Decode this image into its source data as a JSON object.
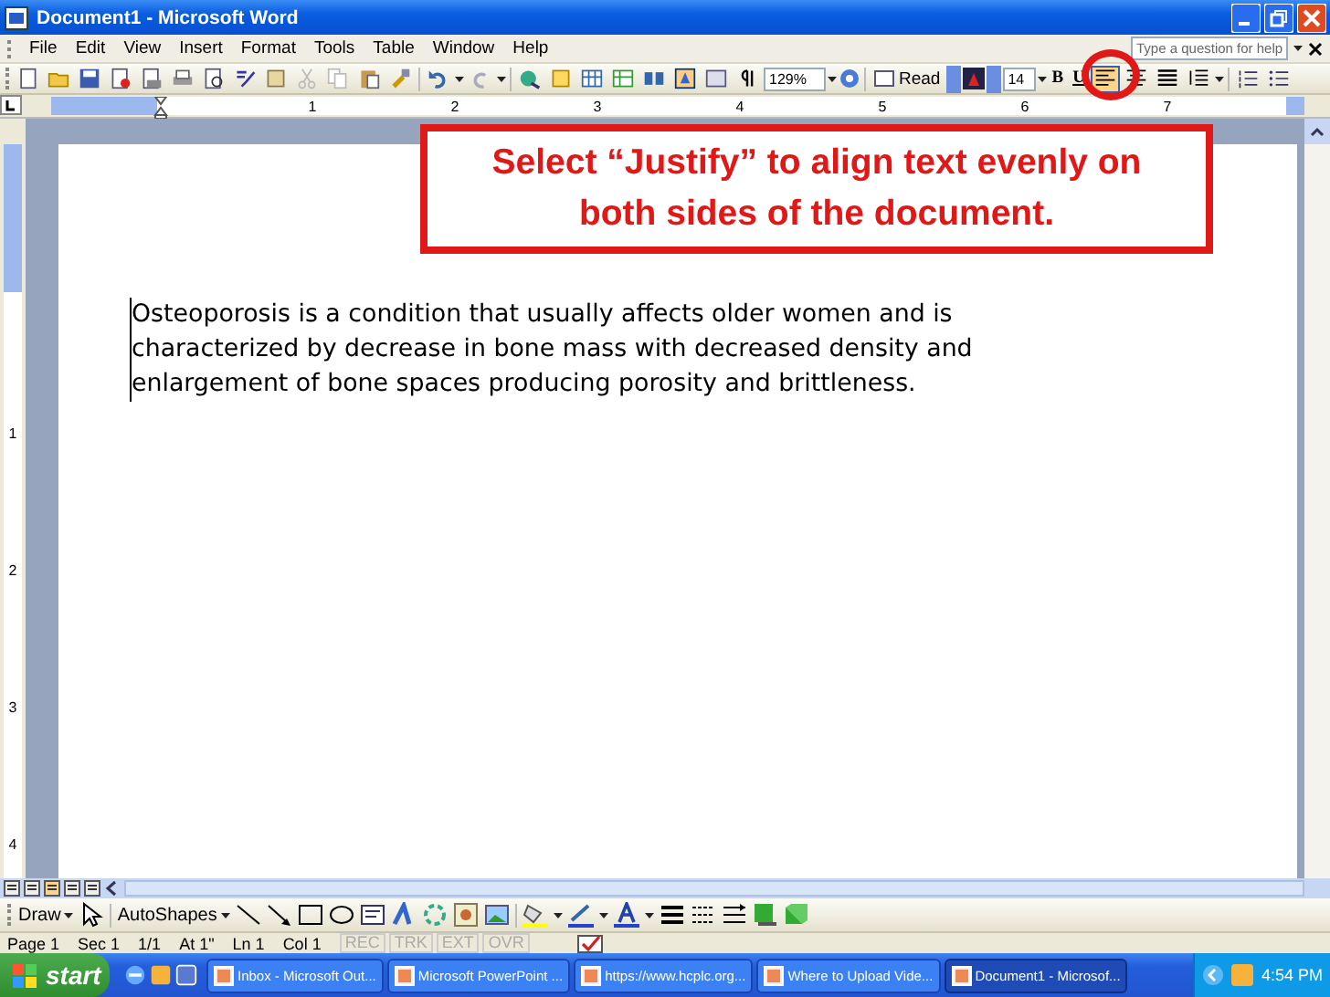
{
  "window": {
    "title": "Document1 - Microsoft Word"
  },
  "menu": [
    {
      "label": "File"
    },
    {
      "label": "Edit"
    },
    {
      "label": "View"
    },
    {
      "label": "Insert"
    },
    {
      "label": "Format"
    },
    {
      "label": "Tools"
    },
    {
      "label": "Table"
    },
    {
      "label": "Window"
    },
    {
      "label": "Help"
    }
  ],
  "help_box": {
    "placeholder": "Type a question for help"
  },
  "toolbar": {
    "zoom": "129%",
    "read": "Read",
    "font_size": "14",
    "bold": "B",
    "underline": "U",
    "alignment": [
      {
        "kind": "left",
        "selected": true
      },
      {
        "kind": "center",
        "selected": false
      },
      {
        "kind": "justify",
        "selected": false
      }
    ]
  },
  "ruler": {
    "labels": [
      "1",
      "2",
      "3",
      "4",
      "5",
      "6",
      "7"
    ]
  },
  "vertical_ruler": {
    "labels": [
      "1",
      "2",
      "3",
      "4"
    ]
  },
  "document": {
    "paragraph": "Osteoporosis is a condition that usually affects older women and is characterized by decrease in bone mass with decreased density and enlargement of bone spaces producing porosity and brittleness."
  },
  "callout": {
    "text": "Select “Justify” to align text evenly on both sides of the document."
  },
  "draw_toolbar": {
    "draw": "Draw",
    "autoshapes": "AutoShapes"
  },
  "status_bar": [
    {
      "text": "Page 1",
      "disabled": false
    },
    {
      "text": "Sec 1",
      "disabled": false
    },
    {
      "text": "1/1",
      "disabled": false
    },
    {
      "text": "At 1\"",
      "disabled": false
    },
    {
      "text": "Ln 1",
      "disabled": false
    },
    {
      "text": "Col 1",
      "disabled": false
    },
    {
      "text": "REC",
      "disabled": true
    },
    {
      "text": "TRK",
      "disabled": true
    },
    {
      "text": "EXT",
      "disabled": true
    },
    {
      "text": "OVR",
      "disabled": true
    }
  ],
  "taskbar": {
    "start": "start",
    "tasks": [
      {
        "label": "Inbox - Microsoft Out...",
        "selected": false
      },
      {
        "label": "Microsoft PowerPoint ...",
        "selected": false
      },
      {
        "label": "https://www.hcplc.org...",
        "selected": false
      },
      {
        "label": "Where to Upload Vide...",
        "selected": false
      },
      {
        "label": "Document1 - Microsof...",
        "selected": true
      }
    ],
    "clock": "4:54 PM"
  }
}
